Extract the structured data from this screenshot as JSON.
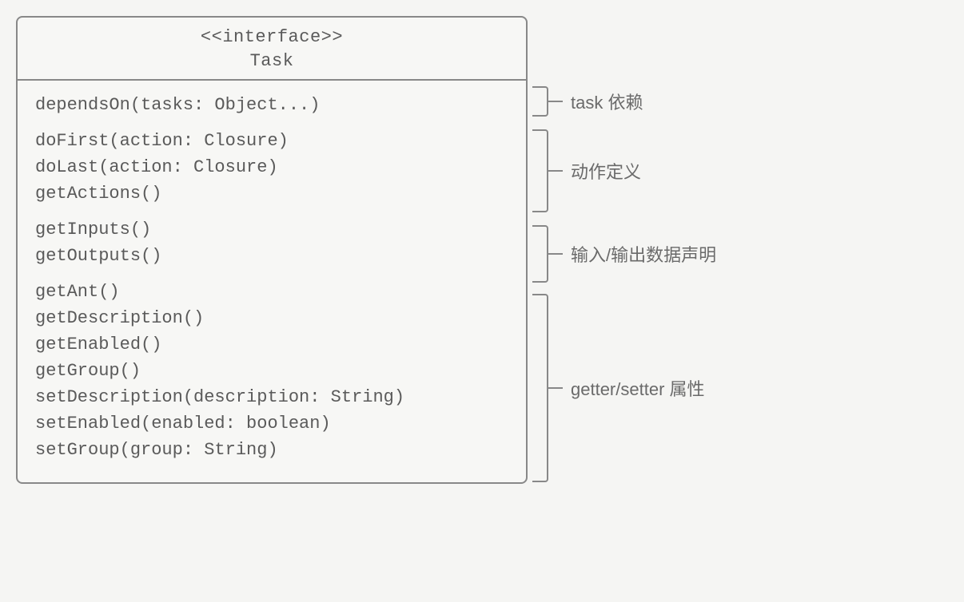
{
  "header": {
    "stereotype": "<<interface>>",
    "name": "Task"
  },
  "groups": [
    {
      "annotation": "task 依赖",
      "methods": [
        "dependsOn(tasks: Object...)"
      ]
    },
    {
      "annotation": "动作定义",
      "methods": [
        "doFirst(action: Closure)",
        "doLast(action: Closure)",
        "getActions()"
      ]
    },
    {
      "annotation": "输入/输出数据声明",
      "methods": [
        "getInputs()",
        "getOutputs()"
      ]
    },
    {
      "annotation": "getter/setter 属性",
      "methods": [
        "getAnt()",
        "getDescription()",
        "getEnabled()",
        "getGroup()",
        "setDescription(description: String)",
        "setEnabled(enabled: boolean)",
        "setGroup(group: String)"
      ]
    }
  ],
  "layout": {
    "lineHeight": 33,
    "groupPad": 12,
    "bracketHeights": [
      38,
      104,
      72,
      236
    ],
    "bracketGaps": [
      0,
      16,
      16,
      14
    ]
  }
}
